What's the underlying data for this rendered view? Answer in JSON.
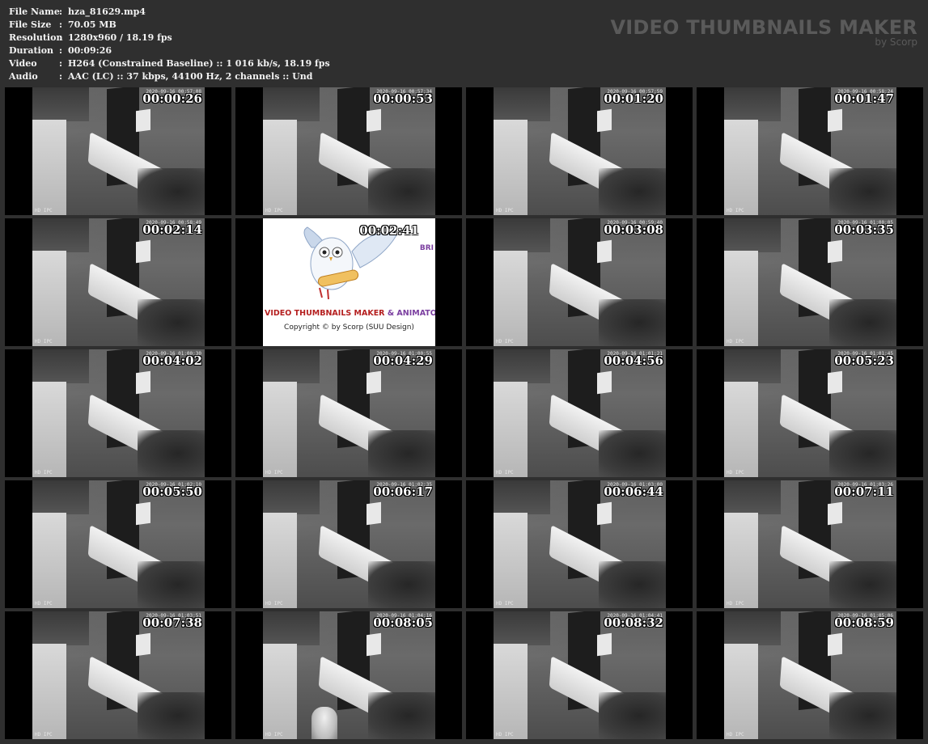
{
  "meta": {
    "rows": [
      {
        "label": "File Name",
        "value": "hza_81629.mp4"
      },
      {
        "label": "File Size",
        "value": "70.05 MB"
      },
      {
        "label": "Resolution",
        "value": "1280x960 / 18.19 fps"
      },
      {
        "label": "Duration",
        "value": "00:09:26"
      },
      {
        "label": "Video",
        "value": "H264 (Constrained Baseline) :: 1 016 kb/s, 18.19 fps"
      },
      {
        "label": "Audio",
        "value": "AAC (LC) :: 37 kbps, 44100 Hz, 2 channels :: Und"
      }
    ],
    "separator": ":"
  },
  "brand": {
    "title": "VIDEO THUMBNAILS MAKER",
    "subtitle": "by Scorp"
  },
  "osd_camera_label": "HD IPC",
  "logo": {
    "timestamp": "00:02:41",
    "title_part1": "VIDEO THUMBNAILS MAKER",
    "title_part2": "& ANIMATO",
    "copyright": "Copyright © by Scorp (SUU Design)",
    "side_text": "BRI"
  },
  "thumbnails": [
    {
      "time": "00:00:26",
      "date": "2020-09-16 00:57:08"
    },
    {
      "time": "00:00:53",
      "date": "2020-09-16 00:57:34"
    },
    {
      "time": "00:01:20",
      "date": "2020-09-16 00:57:59"
    },
    {
      "time": "00:01:47",
      "date": "2020-09-16 00:58:24"
    },
    {
      "time": "00:02:14",
      "date": "2020-09-16 00:58:49"
    },
    {
      "time": "00:02:41",
      "date": "",
      "logo": true
    },
    {
      "time": "00:03:08",
      "date": "2020-09-16 00:59:40"
    },
    {
      "time": "00:03:35",
      "date": "2020-09-16 01:00:05"
    },
    {
      "time": "00:04:02",
      "date": "2020-09-16 01:00:30"
    },
    {
      "time": "00:04:29",
      "date": "2020-09-16 01:00:55"
    },
    {
      "time": "00:04:56",
      "date": "2020-09-16 01:01:21"
    },
    {
      "time": "00:05:23",
      "date": "2020-09-16 01:01:45"
    },
    {
      "time": "00:05:50",
      "date": "2020-09-16 01:02:10"
    },
    {
      "time": "00:06:17",
      "date": "2020-09-16 01:02:35"
    },
    {
      "time": "00:06:44",
      "date": "2020-09-16 01:03:00"
    },
    {
      "time": "00:07:11",
      "date": "2020-09-16 01:03:26"
    },
    {
      "time": "00:07:38",
      "date": "2020-09-16 01:03:51"
    },
    {
      "time": "00:08:05",
      "date": "2020-09-16 01:04:16"
    },
    {
      "time": "00:08:32",
      "date": "2020-09-16 01:04:41"
    },
    {
      "time": "00:08:59",
      "date": "2020-09-16 01:05:06"
    }
  ]
}
